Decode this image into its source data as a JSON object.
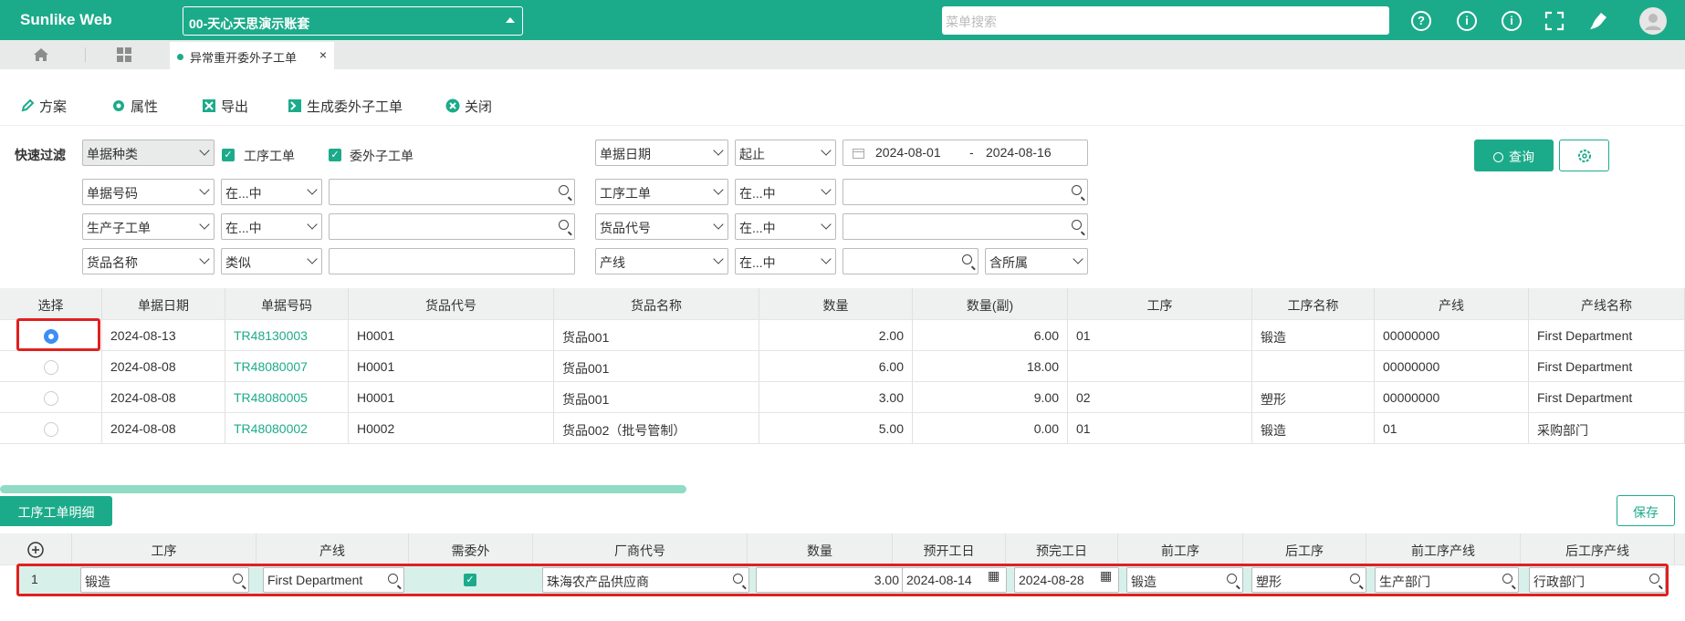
{
  "app": {
    "title": "Sunlike Web",
    "account": "00-天心天思演示账套",
    "search_placeholder": "菜单搜索",
    "help": "?",
    "info1": "i",
    "info2": "i"
  },
  "tabs": {
    "active": "异常重开委外子工单",
    "close": "×"
  },
  "toolbar": {
    "scheme": "方案",
    "props": "属性",
    "export": "导出",
    "generate": "生成委外子工单",
    "close": "关闭"
  },
  "filter": {
    "quick_label": "快速过滤",
    "doc_type": "单据种类",
    "cb1": "工序工单",
    "cb2": "委外子工单",
    "date_field": "单据日期",
    "date_op": "起止",
    "date_from": "2024-08-01",
    "date_sep": "-",
    "date_to": "2024-08-16",
    "f_docno": "单据号码",
    "op_in": "在...中",
    "f_procorder": "工序工单",
    "f_prodsub": "生产子工单",
    "f_itemcode": "货品代号",
    "f_itemname": "货品名称",
    "op_like": "类似",
    "f_line": "产线",
    "f_sub": "含所属",
    "query": "查询"
  },
  "table": {
    "headers": [
      "选择",
      "单据日期",
      "单据号码",
      "货品代号",
      "货品名称",
      "数量",
      "数量(副)",
      "工序",
      "工序名称",
      "产线",
      "产线名称"
    ],
    "rows": [
      {
        "selected": true,
        "date": "2024-08-13",
        "no": "TR48130003",
        "code": "H0001",
        "name": "货品001",
        "qty": "2.00",
        "qty2": "6.00",
        "proc": "01",
        "procname": "锻造",
        "line": "00000000",
        "linename": "First Department"
      },
      {
        "selected": false,
        "date": "2024-08-08",
        "no": "TR48080007",
        "code": "H0001",
        "name": "货品001",
        "qty": "6.00",
        "qty2": "18.00",
        "proc": "",
        "procname": "",
        "line": "00000000",
        "linename": "First Department"
      },
      {
        "selected": false,
        "date": "2024-08-08",
        "no": "TR48080005",
        "code": "H0001",
        "name": "货品001",
        "qty": "3.00",
        "qty2": "9.00",
        "proc": "02",
        "procname": "塑形",
        "line": "00000000",
        "linename": "First Department"
      },
      {
        "selected": false,
        "date": "2024-08-08",
        "no": "TR48080002",
        "code": "H0002",
        "name": "货品002（批号管制）",
        "qty": "5.00",
        "qty2": "0.00",
        "proc": "01",
        "procname": "锻造",
        "line": "01",
        "linename": "采购部门"
      }
    ]
  },
  "detail": {
    "section": "工序工单明细",
    "save": "保存",
    "headers": [
      "工序",
      "产线",
      "需委外",
      "厂商代号",
      "数量",
      "预开工日",
      "预完工日",
      "前工序",
      "后工序",
      "前工序产线",
      "后工序产线"
    ],
    "row": {
      "idx": "1",
      "proc": "锻造",
      "line": "First Department",
      "outsource": true,
      "vendor": "珠海农产品供应商",
      "qty": "3.00",
      "start": "2024-08-14",
      "end": "2024-08-28",
      "prev": "锻造",
      "next": "塑形",
      "prevline": "生产部门",
      "nextline": "行政部门"
    }
  },
  "colors": {
    "accent": "#1cab8a",
    "highlight": "#e02020"
  }
}
